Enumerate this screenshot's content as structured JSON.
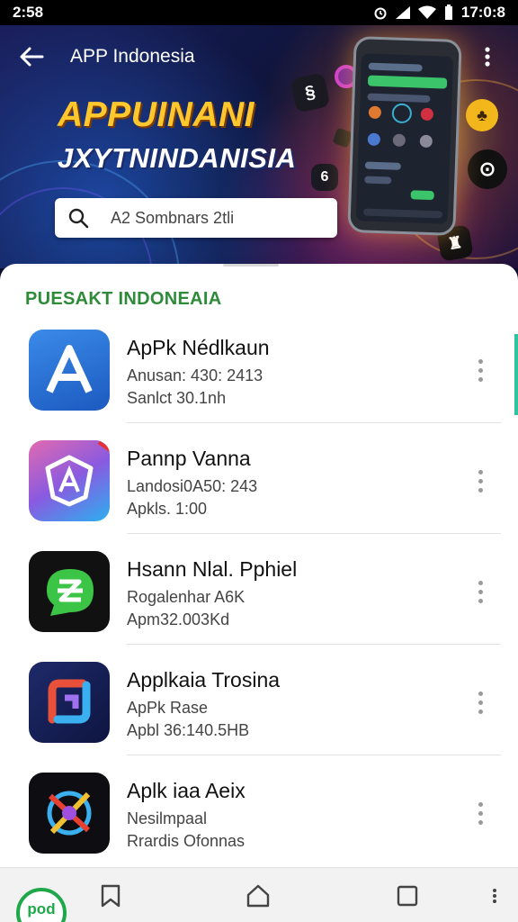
{
  "status_bar": {
    "time": "2:58",
    "right_time": "17:0:8"
  },
  "header": {
    "title": "APP Indonesia",
    "headline": "APPUINANI",
    "subline": "JXYTNINDANISIA"
  },
  "search": {
    "text": "A2 Sombnars 2tli"
  },
  "section": {
    "title": "PUESAKT INDONEAIA"
  },
  "apps": [
    {
      "name": "ApPk Nédlkaun",
      "line2": "Anusan: 430: 2413",
      "line3": "Sanlct 30.1nh",
      "icon": "letter-a-icon"
    },
    {
      "name": "Pannp Vanna",
      "line2": "Landosi0A50: 243",
      "line3": "Apkls. 1:00",
      "icon": "shield-a-icon"
    },
    {
      "name": "Hsann Nlal. Pphiel",
      "line2": "Rogalenhar A6K",
      "line3": "Apm32.003Kd",
      "icon": "chat-z-icon"
    },
    {
      "name": "Applkaia Trosina",
      "line2": "ApPk Rase",
      "line3": "Apbl 36:140.5HB",
      "icon": "square-swirl-icon"
    },
    {
      "name": "Aplk iaa Aeix",
      "line2": "Nesilmpaal",
      "line3": "Rrardis Ofonnas",
      "icon": "compass-icon"
    }
  ],
  "nav": {
    "logo_text": "pod"
  },
  "colors": {
    "accent_green": "#2e8b3a",
    "headline_yellow": "#ffc72e",
    "hero_bg": "#0d1338"
  }
}
